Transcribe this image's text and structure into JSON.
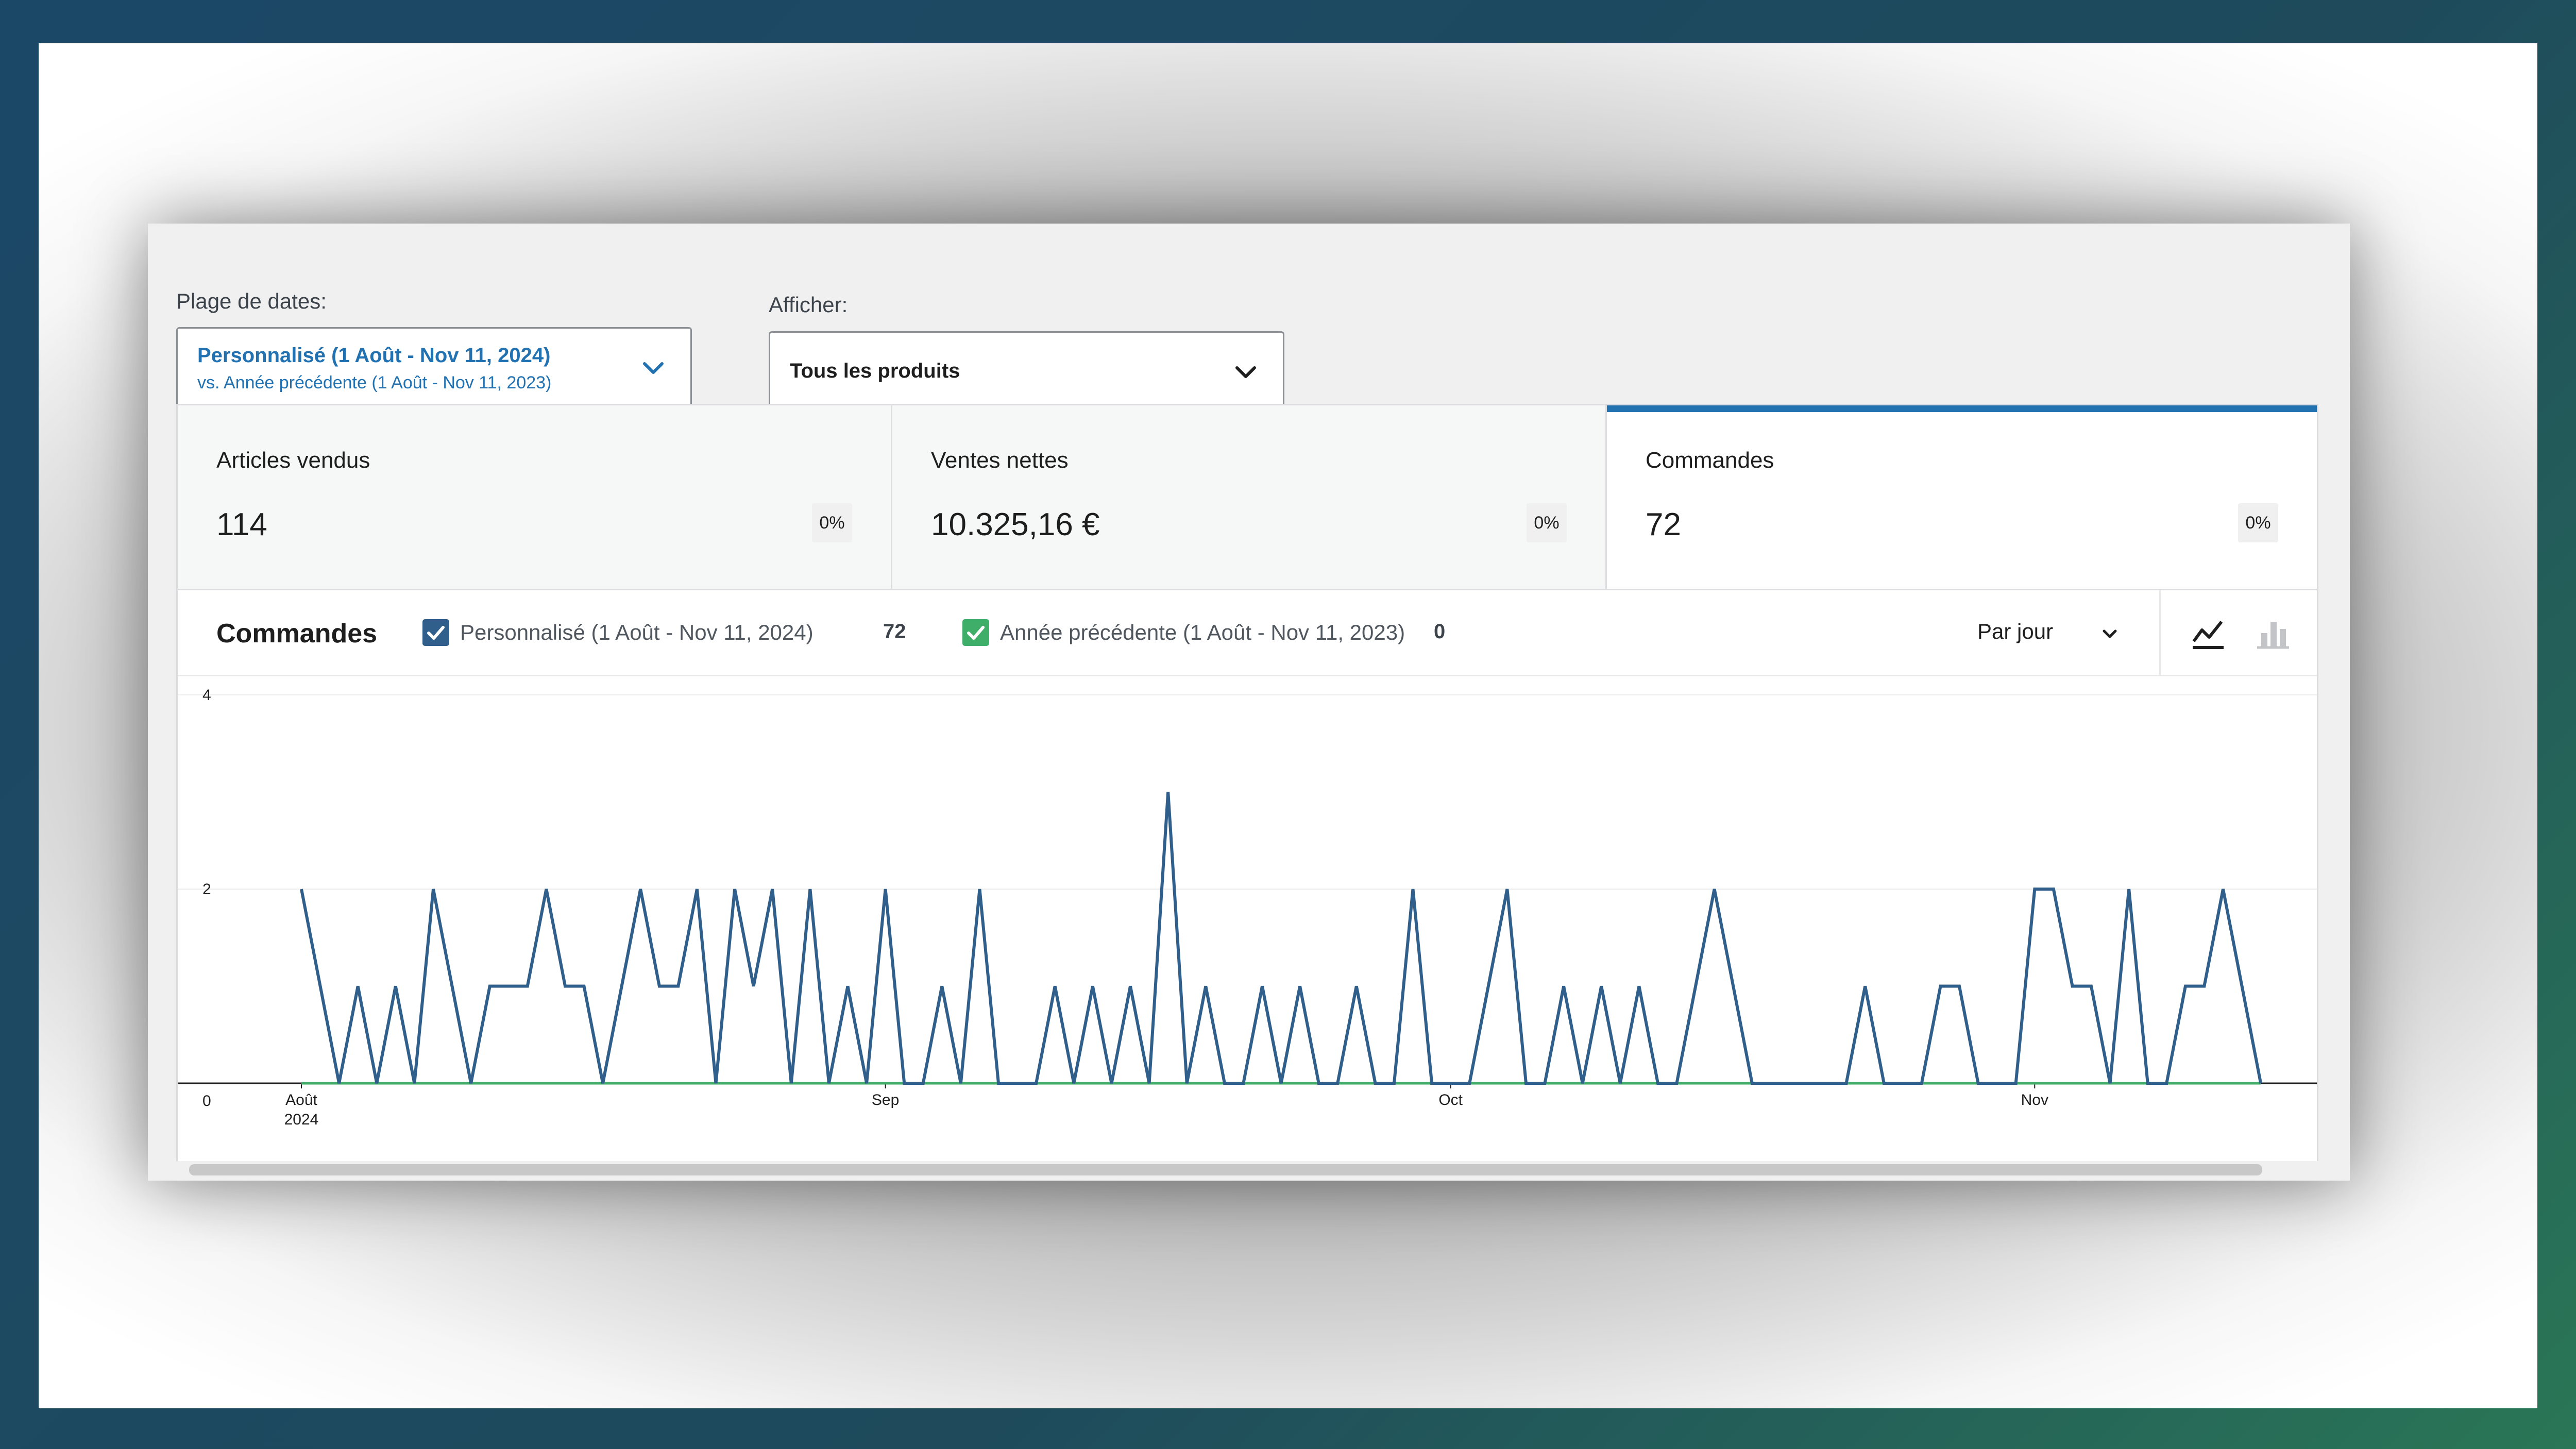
{
  "filters": {
    "date_range": {
      "label": "Plage de dates:",
      "primary": "Personnalisé (1 Août - Nov 11, 2024)",
      "comparison": "vs. Année précédente (1 Août - Nov 11, 2023)"
    },
    "show": {
      "label": "Afficher:",
      "value": "Tous les produits"
    }
  },
  "cards": [
    {
      "label": "Articles vendus",
      "value": "114",
      "delta": "0%"
    },
    {
      "label": "Ventes nettes",
      "value": "10.325,16 €",
      "delta": "0%"
    },
    {
      "label": "Commandes",
      "value": "72",
      "delta": "0%",
      "active": true
    }
  ],
  "chart_header": {
    "title": "Commandes",
    "legend": [
      {
        "label": "Personnalisé (1 Août - Nov 11, 2024)",
        "total": "72",
        "color": "#2f5f8a"
      },
      {
        "label": "Année précédente (1 Août - Nov 11, 2023)",
        "total": "0",
        "color": "#3fae68"
      }
    ],
    "interval": "Par jour",
    "icons": [
      "line-chart-icon",
      "bar-chart-icon"
    ]
  },
  "chart_data": {
    "type": "line",
    "x_start": "2024-08-01",
    "x_end": "2024-11-11",
    "ylim": [
      0,
      4
    ],
    "y_ticks": [
      "0",
      "2",
      "4"
    ],
    "x_ticks": [
      {
        "date": "2024-08-01",
        "label": "Août",
        "sublabel": "2024"
      },
      {
        "date": "2024-09-01",
        "label": "Sep"
      },
      {
        "date": "2024-10-01",
        "label": "Oct"
      },
      {
        "date": "2024-11-01",
        "label": "Nov"
      }
    ],
    "series": [
      {
        "name": "Personnalisé (1 Août - Nov 11, 2024)",
        "color": "#2f5f8a",
        "values": [
          2,
          1,
          0,
          1,
          0,
          1,
          0,
          2,
          1,
          0,
          1,
          1,
          1,
          2,
          1,
          1,
          0,
          1,
          2,
          1,
          1,
          2,
          0,
          2,
          1,
          2,
          0,
          2,
          0,
          1,
          0,
          2,
          0,
          0,
          1,
          0,
          2,
          0,
          0,
          0,
          1,
          0,
          1,
          0,
          1,
          0,
          3,
          0,
          1,
          0,
          0,
          1,
          0,
          1,
          0,
          0,
          1,
          0,
          0,
          2,
          0,
          0,
          0,
          1,
          2,
          0,
          0,
          1,
          0,
          1,
          0,
          1,
          0,
          0,
          1,
          2,
          1,
          0,
          0,
          0,
          0,
          0,
          0,
          1,
          0,
          0,
          0,
          1,
          1,
          0,
          0,
          0,
          2,
          2,
          1,
          1,
          0,
          2,
          0,
          0,
          1,
          1,
          2,
          1,
          0
        ]
      },
      {
        "name": "Année précédente (1 Août - Nov 11, 2023)",
        "color": "#3fae68",
        "values": [
          0,
          0,
          0,
          0,
          0,
          0,
          0,
          0,
          0,
          0,
          0,
          0,
          0,
          0,
          0,
          0,
          0,
          0,
          0,
          0,
          0,
          0,
          0,
          0,
          0,
          0,
          0,
          0,
          0,
          0,
          0,
          0,
          0,
          0,
          0,
          0,
          0,
          0,
          0,
          0,
          0,
          0,
          0,
          0,
          0,
          0,
          0,
          0,
          0,
          0,
          0,
          0,
          0,
          0,
          0,
          0,
          0,
          0,
          0,
          0,
          0,
          0,
          0,
          0,
          0,
          0,
          0,
          0,
          0,
          0,
          0,
          0,
          0,
          0,
          0,
          0,
          0,
          0,
          0,
          0,
          0,
          0,
          0,
          0,
          0,
          0,
          0,
          0,
          0,
          0,
          0,
          0,
          0,
          0,
          0,
          0,
          0,
          0,
          0,
          0,
          0,
          0,
          0,
          0,
          0
        ]
      }
    ]
  }
}
